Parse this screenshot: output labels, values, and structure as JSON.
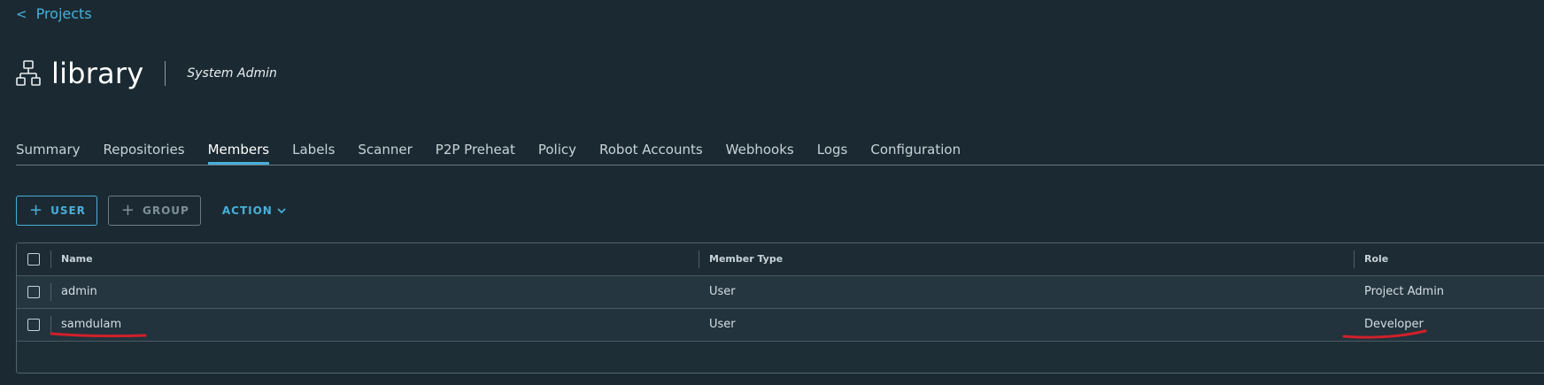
{
  "breadcrumb": {
    "chevron": "<",
    "label": "Projects"
  },
  "header": {
    "icon": "project-icon",
    "title": "library",
    "role": "System Admin"
  },
  "tabs": [
    {
      "label": "Summary",
      "active": false
    },
    {
      "label": "Repositories",
      "active": false
    },
    {
      "label": "Members",
      "active": true
    },
    {
      "label": "Labels",
      "active": false
    },
    {
      "label": "Scanner",
      "active": false
    },
    {
      "label": "P2P Preheat",
      "active": false
    },
    {
      "label": "Policy",
      "active": false
    },
    {
      "label": "Robot Accounts",
      "active": false
    },
    {
      "label": "Webhooks",
      "active": false
    },
    {
      "label": "Logs",
      "active": false
    },
    {
      "label": "Configuration",
      "active": false
    }
  ],
  "toolbar": {
    "user_label": "USER",
    "group_label": "GROUP",
    "action_label": "ACTION"
  },
  "table": {
    "columns": [
      "Name",
      "Member Type",
      "Role"
    ],
    "rows": [
      {
        "name": "admin",
        "type": "User",
        "role": "Project Admin"
      },
      {
        "name": "samdulam",
        "type": "User",
        "role": "Developer"
      }
    ]
  },
  "colors": {
    "background": "#1b2a32",
    "accent": "#49afd9",
    "annotation": "#d0202a"
  }
}
